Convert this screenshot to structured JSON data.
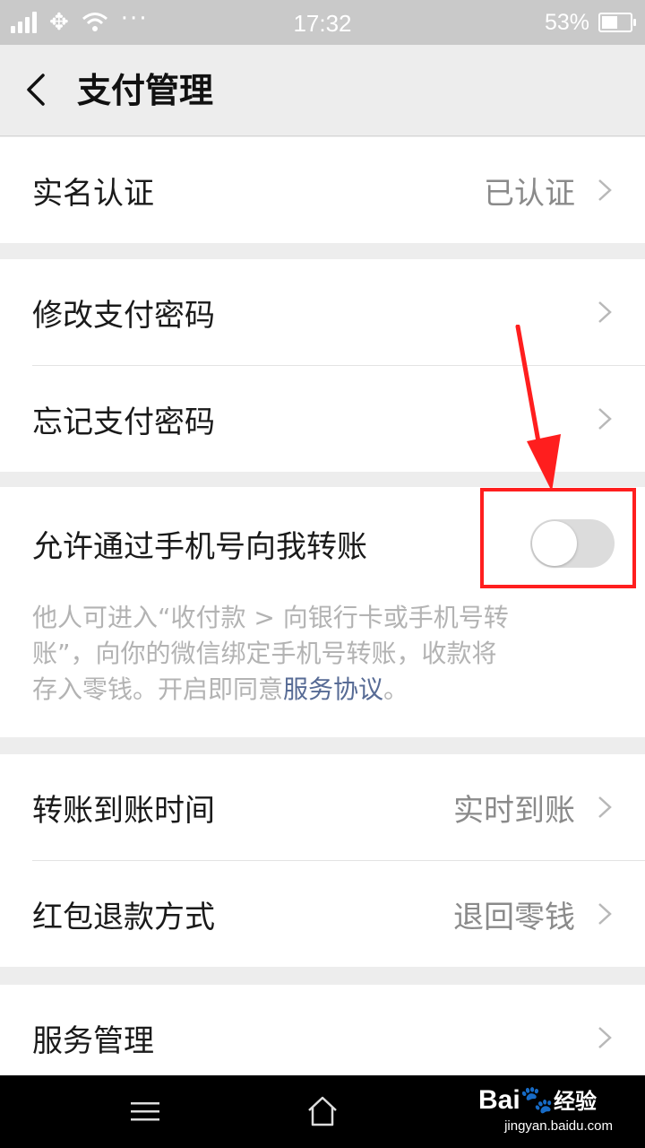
{
  "status_bar": {
    "time": "17:32",
    "battery": "53%",
    "battery_level": 0.53,
    "carrier_icon": "carrier-logo-icon"
  },
  "nav": {
    "title": "支付管理",
    "back_icon": "chevron-left-icon"
  },
  "groups": [
    {
      "rows": [
        {
          "label": "实名认证",
          "value": "已认证"
        }
      ]
    },
    {
      "rows": [
        {
          "label": "修改支付密码",
          "value": ""
        },
        {
          "label": "忘记支付密码",
          "value": ""
        }
      ]
    }
  ],
  "transfer_setting": {
    "label": "允许通过手机号向我转账",
    "enabled": false,
    "desc_line1": "他人可进入“收付款 > 向银行卡或手机号转",
    "desc_line2": "账”，向你的微信绑定手机号转账，收款将",
    "desc_line3_prefix": "存入零钱。开启即同意",
    "desc_link": "服务协议",
    "desc_suffix": "。",
    "link_color": "#576b95"
  },
  "groups2": [
    {
      "rows": [
        {
          "label": "转账到账时间",
          "value": "实时到账"
        },
        {
          "label": "红包退款方式",
          "value": "退回零钱"
        }
      ]
    },
    {
      "rows": [
        {
          "label": "服务管理",
          "value": ""
        }
      ]
    }
  ],
  "watermark": {
    "brand": "Bai",
    "brand_suffix": "经验",
    "url": "jingyan.baidu.com"
  },
  "colors": {
    "annotation": "#ff1e1e",
    "toggle_off": "#dcdcdc"
  }
}
